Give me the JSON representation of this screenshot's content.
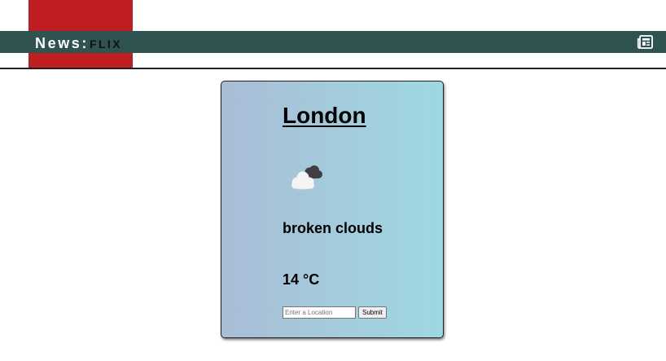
{
  "header": {
    "brand_news": "News:",
    "brand_flix": "FLIX",
    "news_icon": "newspaper-icon"
  },
  "colors": {
    "logo_red": "#be1e22",
    "topbar": "#2f5351",
    "card_gradient_start": "#a9bdd6",
    "card_gradient_end": "#9ed8e1"
  },
  "weather": {
    "city": "London",
    "icon": "broken-clouds-icon",
    "description": "broken clouds",
    "temperature": "14 °C"
  },
  "form": {
    "location_placeholder": "Enter a Location",
    "location_value": "",
    "submit_label": "Submit"
  }
}
